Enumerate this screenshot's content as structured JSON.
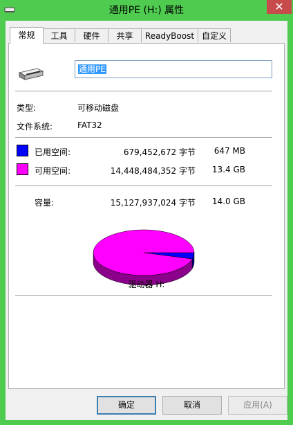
{
  "window": {
    "title": "通用PE (H:) 属性",
    "close_glyph": "✕"
  },
  "tabs": [
    {
      "label": "常规",
      "active": true
    },
    {
      "label": "工具"
    },
    {
      "label": "硬件"
    },
    {
      "label": "共享"
    },
    {
      "label": "ReadyBoost"
    },
    {
      "label": "自定义"
    }
  ],
  "general": {
    "drive_name": "通用PE",
    "type_label": "类型:",
    "type_value": "可移动磁盘",
    "fs_label": "文件系统:",
    "fs_value": "FAT32",
    "used_label": "已用空间:",
    "used_bytes": "679,452,672 字节",
    "used_size": "647 MB",
    "free_label": "可用空间:",
    "free_bytes": "14,448,484,352 字节",
    "free_size": "13.4 GB",
    "capacity_label": "容量:",
    "capacity_bytes": "15,127,937,024 字节",
    "capacity_size": "14.0 GB",
    "drive_label": "驱动器 H:"
  },
  "chart_data": {
    "type": "pie",
    "categories": [
      "已用空间",
      "可用空间"
    ],
    "values": [
      679452672,
      14448484352
    ],
    "colors": [
      "#0000ff",
      "#ff00ff"
    ]
  },
  "buttons": {
    "ok": "确定",
    "cancel": "取消",
    "apply": "应用(A)"
  },
  "colors": {
    "titlebar": "#4fcb4f",
    "used": "#0000ff",
    "free": "#ff00ff",
    "close": "#c74b4b"
  }
}
